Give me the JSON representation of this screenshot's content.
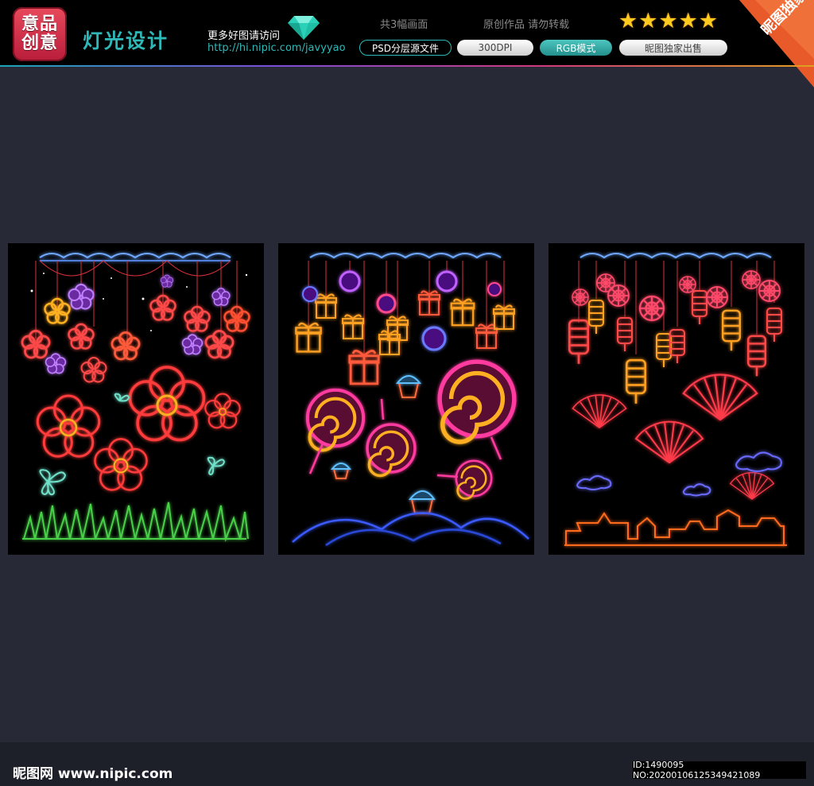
{
  "header": {
    "logo_line1": "意品",
    "logo_line2": "创意",
    "title": "灯光设计",
    "more_text": "更多好图请访问",
    "url": "http://hi.nipic.com/javyyao",
    "count_text": "共3幅画面",
    "original_text": "原创作品 请勿转载",
    "tags": [
      "PSD分层源文件",
      "300DPI",
      "RGB模式",
      "昵图独家出售"
    ],
    "rating": 5,
    "ribbon_text": "昵图独家",
    "icons": [
      "diamond-icon",
      "star-icon"
    ],
    "accent_color": "#2fb8b8"
  },
  "panels": [
    {
      "name": "flowers-panel",
      "theme": "neon flowers and butterflies over grass"
    },
    {
      "name": "candy-panel",
      "theme": "neon gift boxes, lollipops and cupcakes"
    },
    {
      "name": "lanterns-panel",
      "theme": "neon lanterns, fans, clouds and pavilion skyline"
    }
  ],
  "footer": {
    "watermark": "昵图网 www.nipic.com",
    "id_text": "ID:1490095 NO:20200106125349421089"
  }
}
